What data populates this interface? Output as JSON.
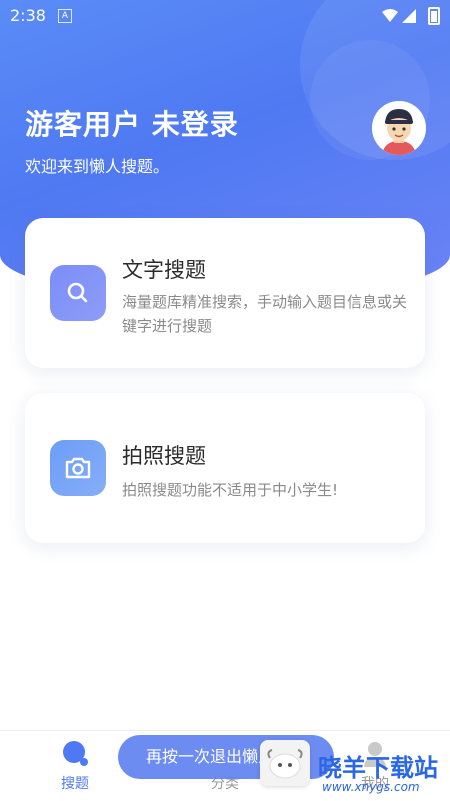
{
  "status": {
    "time": "2:38"
  },
  "header": {
    "user_title": "游客用户 未登录",
    "welcome": "欢迎来到懒人搜题。"
  },
  "cards": [
    {
      "title": "文字搜题",
      "desc": "海量题库精准搜索，手动输入题目信息或关键字进行搜题",
      "icon": "search-icon"
    },
    {
      "title": "拍照搜题",
      "desc": "拍照搜题功能不适用于中小学生!",
      "icon": "camera-icon"
    }
  ],
  "tabs": [
    {
      "label": "搜题",
      "active": true
    },
    {
      "label": "分类",
      "active": false
    },
    {
      "label": "我的",
      "active": false
    }
  ],
  "toast": "再按一次退出懒人搜题",
  "watermark": {
    "text": "晓羊下载站",
    "url": "www.xnygs.com"
  },
  "colors": {
    "accent": "#4f79f2",
    "hero": "#5a8cf7"
  }
}
